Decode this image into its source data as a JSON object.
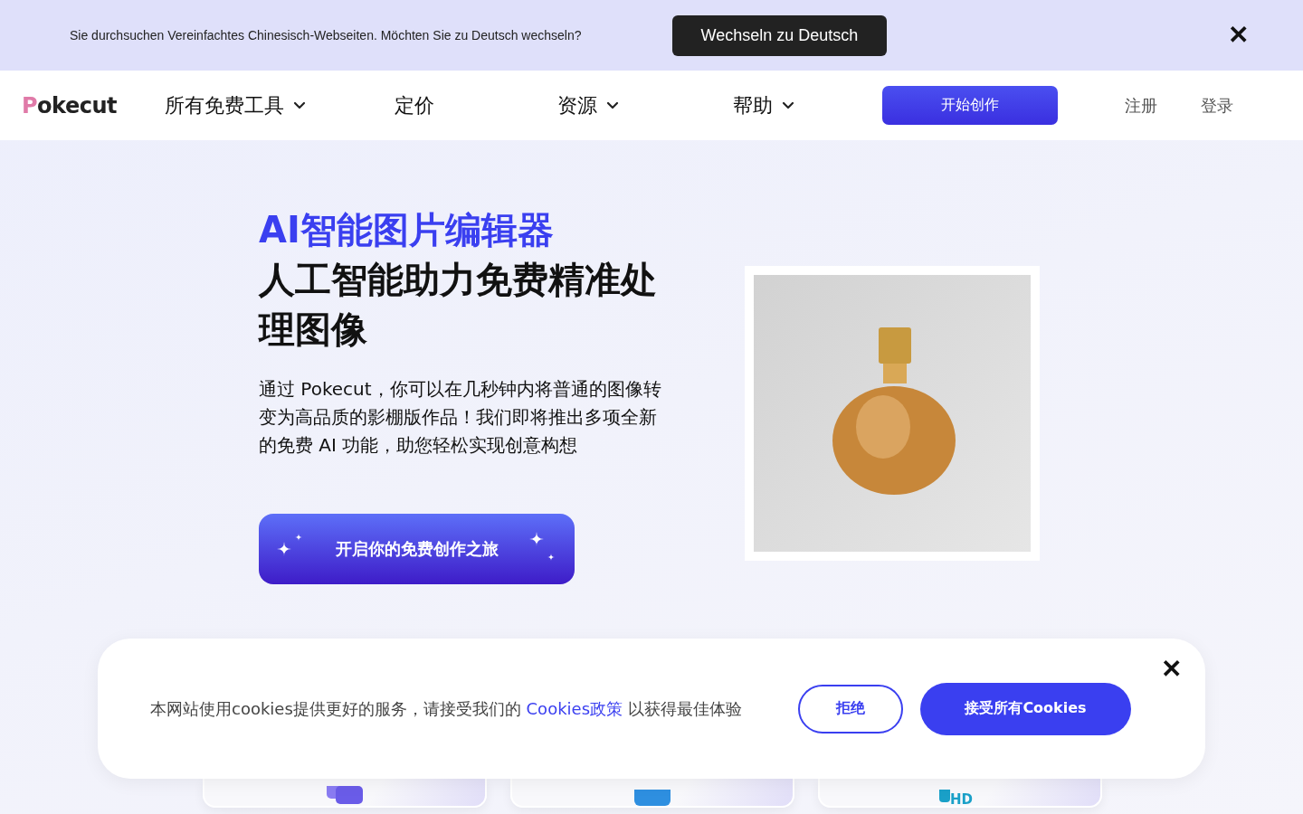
{
  "language_bar": {
    "message": "Sie durchsuchen Vereinfachtes Chinesisch-Webseiten. Möchten Sie zu Deutsch wechseln?",
    "switch_button": "Wechseln zu Deutsch",
    "close": "✕"
  },
  "nav": {
    "logo": "Pokecut",
    "items": [
      {
        "label": "所有免费工具",
        "dropdown": true
      },
      {
        "label": "定价",
        "dropdown": false
      },
      {
        "label": "资源",
        "dropdown": true
      },
      {
        "label": "帮助",
        "dropdown": true
      }
    ],
    "cta": "开始创作",
    "signup": "注册",
    "login": "登录"
  },
  "hero": {
    "title_accent": "AI智能图片编辑器",
    "title": "人工智能助力免费精准处理图像",
    "description": "通过 Pokecut，你可以在几秒钟内将普通的图像转变为高品质的影棚版作品！我们即将推出多项全新的免费 AI 功能，助您轻松实现创意构想",
    "cta": "开启你的免费创作之旅"
  },
  "tool_cards": [
    {
      "kind": "layers"
    },
    {
      "kind": "screen"
    },
    {
      "kind": "hd",
      "icon_text": "HD"
    }
  ],
  "cookie_banner": {
    "text_before": "本网站使用cookies提供更好的服务，请接受我们的",
    "link": "Cookies政策",
    "text_after": "以获得最佳体验",
    "reject": "拒绝",
    "accept": "接受所有Cookies",
    "close": "✕"
  }
}
